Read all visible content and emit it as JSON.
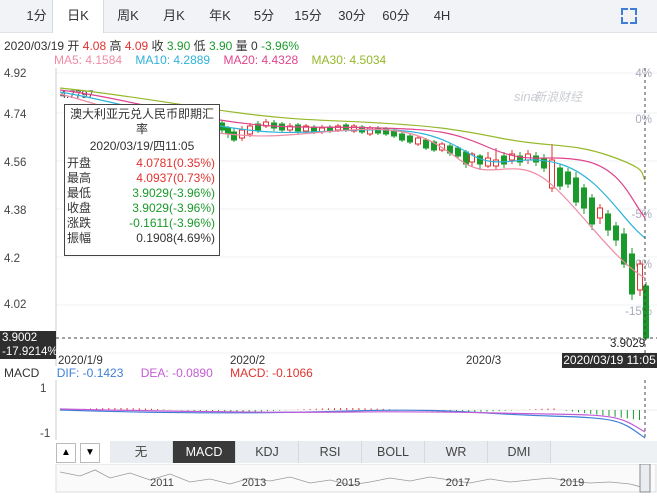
{
  "periods": [
    "1分",
    "日K",
    "周K",
    "月K",
    "年K",
    "5分",
    "15分",
    "30分",
    "60分",
    "4H"
  ],
  "active_period_index": 1,
  "quote": {
    "date": "2020/03/19",
    "open_label": "开",
    "open": "4.08",
    "high_label": "高",
    "high": "4.09",
    "close_label": "收",
    "close": "3.90",
    "low_label": "低",
    "low": "3.90",
    "vol_label": "量",
    "vol": "0",
    "change": "-3.96%"
  },
  "ma": [
    {
      "label": "MA5: 4.1584",
      "color": "#f08aa5"
    },
    {
      "label": "MA10: 4.2889",
      "color": "#2fb3d9"
    },
    {
      "label": "MA20: 4.4328",
      "color": "#e0448c"
    },
    {
      "label": "MA30: 4.5034",
      "color": "#95b82a"
    }
  ],
  "price_axis": [
    "4.92",
    "4.74",
    "4.56",
    "4.38",
    "4.2",
    "4.02"
  ],
  "pct_axis": [
    "4%",
    "0%",
    "-5%",
    "-10%",
    "-15%"
  ],
  "start_marker": "4.7797",
  "watermark": "新浪财经",
  "tooltip": {
    "title": "澳大利亚元兑人民币即期汇率",
    "datetime": "2020/03/19/四11:05",
    "rows": [
      {
        "k": "开盘",
        "v": "4.0781(0.35%)",
        "color": "#e0322f"
      },
      {
        "k": "最高",
        "v": "4.0937(0.73%)",
        "color": "#e0322f"
      },
      {
        "k": "最低",
        "v": "3.9029(-3.96%)",
        "color": "#1a9a2a"
      },
      {
        "k": "收盘",
        "v": "3.9029(-3.96%)",
        "color": "#1a9a2a"
      },
      {
        "k": "涨跌",
        "v": "-0.1611(-3.96%)",
        "color": "#1a9a2a"
      },
      {
        "k": "振幅",
        "v": "0.1908(4.69%)",
        "color": "#333333"
      }
    ]
  },
  "cursor": {
    "price": "3.9002",
    "pct": "-17.9214%",
    "last": "3.9029",
    "date": "2020/03/19 11:05"
  },
  "x_labels": [
    "2020/1/9",
    "2020/2",
    "2020/3"
  ],
  "macd": {
    "label": "MACD",
    "dif": "DIF: -0.1423",
    "dea": "DEA: -0.0890",
    "macd": "MACD: -0.1066",
    "axis": [
      "1",
      "-1"
    ]
  },
  "indicators": [
    "无",
    "MACD",
    "KDJ",
    "RSI",
    "BOLL",
    "WR",
    "DMI"
  ],
  "active_indicator_index": 1,
  "nav_arrows": [
    "▲",
    "▼"
  ],
  "timeline_years": [
    "2011",
    "2013",
    "2015",
    "2017",
    "2019"
  ],
  "colors": {
    "up": "#e0322f",
    "down": "#1a9a2a",
    "accent": "#3d7fd6"
  }
}
